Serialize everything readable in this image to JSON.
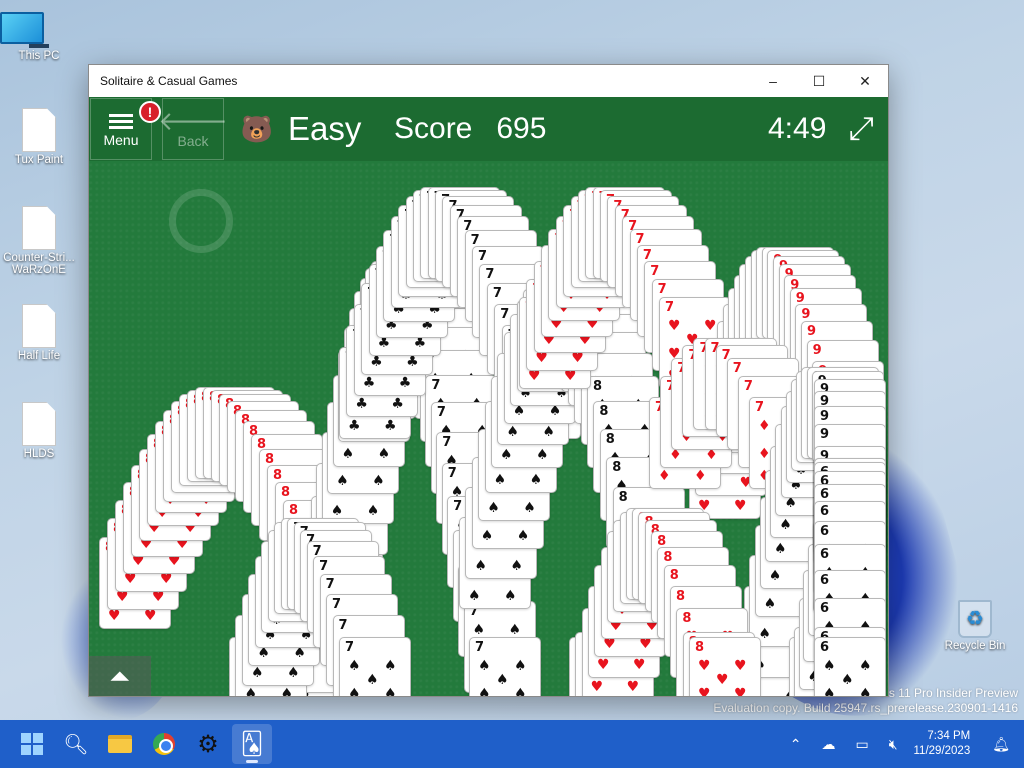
{
  "desktop": {
    "icons": [
      {
        "label": "This PC",
        "icon": "monitor-icon"
      },
      {
        "label": "Tux Paint",
        "icon": "file-shortcut-icon"
      },
      {
        "label": "Counter-Stri... WaRzOnE",
        "icon": "file-shortcut-icon"
      },
      {
        "label": "Half Life",
        "icon": "file-shortcut-icon"
      },
      {
        "label": "HLDS",
        "icon": "file-shortcut-icon"
      },
      {
        "label": "Recycle Bin",
        "icon": "recycle-bin-icon"
      }
    ],
    "watermark_line1": "ws 11 Pro Insider Preview",
    "watermark_line2": "Evaluation copy. Build 25947.rs_prerelease.230901-1416"
  },
  "window": {
    "title": "Solitaire & Casual Games",
    "minimize_glyph": "–",
    "maximize_glyph": "☐",
    "close_glyph": "✕"
  },
  "game": {
    "menu_label": "Menu",
    "menu_badge": "!",
    "back_label": "Back",
    "difficulty": "Easy",
    "score_label": "Score",
    "score_value": "695",
    "timer": "4:49",
    "show_more_glyph": "⏶",
    "colors": {
      "felt": "#237a3c",
      "toolbar": "#1c6b31",
      "red_suit": "#e8141e"
    }
  },
  "cards": [
    {
      "rank": "7",
      "suit": "♣",
      "color": "black"
    },
    {
      "rank": "8",
      "suit": "♥",
      "color": "red"
    },
    {
      "rank": "7",
      "suit": "♠",
      "color": "black"
    },
    {
      "rank": "8",
      "suit": "♠",
      "color": "black"
    },
    {
      "rank": "7",
      "suit": "♥",
      "color": "red"
    },
    {
      "rank": "9",
      "suit": "♠",
      "color": "black"
    },
    {
      "rank": "7",
      "suit": "♦",
      "color": "red"
    },
    {
      "rank": "6",
      "suit": "♠",
      "color": "black"
    },
    {
      "rank": "9",
      "suit": "♥",
      "color": "red"
    }
  ],
  "taskbar": {
    "clock_time": "7:34 PM",
    "clock_date": "11/29/2023",
    "apps": [
      "start-icon",
      "search-icon",
      "file-explorer-icon",
      "chrome-icon",
      "settings-icon",
      "solitaire-icon"
    ]
  }
}
